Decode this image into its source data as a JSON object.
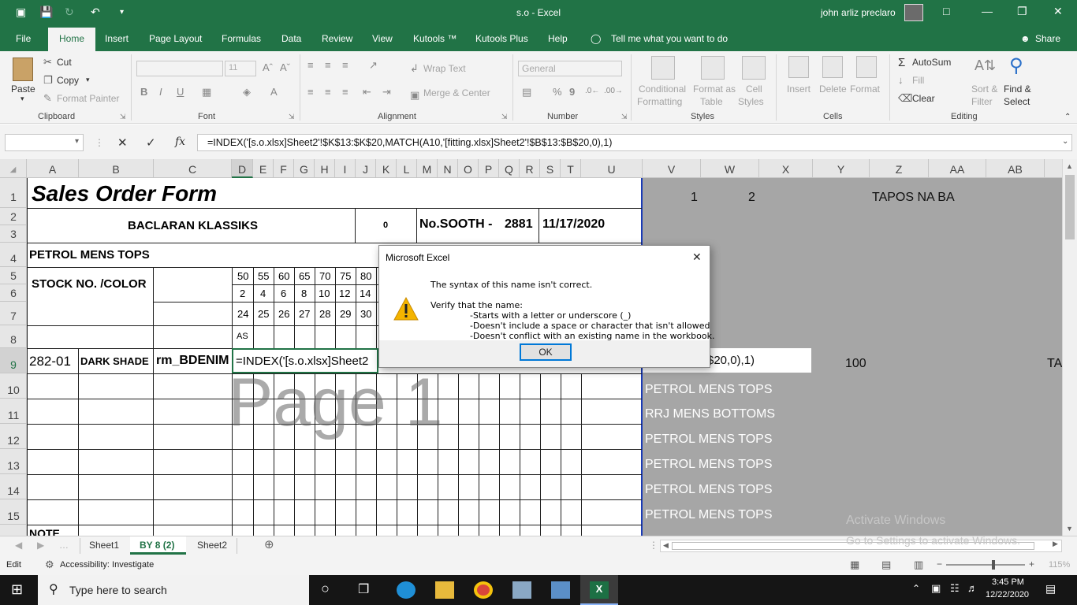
{
  "titlebar": {
    "title": "s.o  -  Excel",
    "user": "john arliz preclaro",
    "minimize": "—",
    "restore": "❐",
    "close": "✕"
  },
  "tabs": [
    "File",
    "Home",
    "Insert",
    "Page Layout",
    "Formulas",
    "Data",
    "Review",
    "View",
    "Kutools ™",
    "Kutools Plus",
    "Help",
    "Tell me what you want to do",
    "Share"
  ],
  "ribbon": {
    "clipboard": {
      "paste": "Paste",
      "cut": "Cut",
      "copy": "Copy",
      "format_painter": "Format Painter",
      "group": "Clipboard"
    },
    "font": {
      "size": "11",
      "group": "Font",
      "bold": "B",
      "italic": "I",
      "underline": "U"
    },
    "alignment": {
      "wrap": "Wrap Text",
      "merge": "Merge & Center",
      "group": "Alignment"
    },
    "number": {
      "format": "General",
      "currency": "$",
      "percent": "%",
      "comma": "9",
      "group": "Number"
    },
    "styles": {
      "conditional": "Conditional",
      "formatting": "Formatting",
      "format_as": "Format as",
      "table": "Table",
      "cell": "Cell",
      "styles_lbl": "Styles",
      "group": "Styles"
    },
    "cells": {
      "insert": "Insert",
      "delete": "Delete",
      "format": "Format",
      "group": "Cells"
    },
    "editing": {
      "autosum": "AutoSum",
      "fill": "Fill",
      "clear": "Clear",
      "sort": "Sort &",
      "filter": "Filter",
      "find": "Find &",
      "select": "Select",
      "group": "Editing"
    }
  },
  "formula_bar": {
    "fx": "fx",
    "cancel": "✕",
    "enter": "✓",
    "formula": "=INDEX('[s.o.xlsx]Sheet2'!$K$13:$K$20,MATCH(A10,'[fitting.xlsx]Sheet2'!$B$13:$B$20,0),1)"
  },
  "columns": [
    "A",
    "B",
    "C",
    "D",
    "E",
    "F",
    "G",
    "H",
    "I",
    "J",
    "K",
    "L",
    "M",
    "N",
    "O",
    "P",
    "Q",
    "R",
    "S",
    "T",
    "U",
    "V",
    "W",
    "X",
    "Y",
    "Z",
    "AA",
    "AB"
  ],
  "rows": [
    "1",
    "2",
    "3",
    "4",
    "5",
    "6",
    "7",
    "8",
    "9",
    "10",
    "11",
    "12",
    "13",
    "14",
    "15"
  ],
  "sheet": {
    "title": "Sales Order Form",
    "customer": "BACLARAN KLASSIKS",
    "zero": "0",
    "no_label": "No.SOOTH -",
    "no_value": "2881",
    "date": "11/17/2020",
    "category": "PETROL MENS TOPS",
    "stock_label": "STOCK NO. /COLOR",
    "sizes_row5": [
      "50",
      "55",
      "60",
      "65",
      "70",
      "75",
      "80"
    ],
    "sizes_row6": [
      "2",
      "4",
      "6",
      "8",
      "10",
      "12",
      "14"
    ],
    "sizes_row7": [
      "24",
      "25",
      "26",
      "27",
      "28",
      "29",
      "30"
    ],
    "as_label": "AS",
    "item_code": "282-01",
    "item_color": "DARK SHADE",
    "item_name": "rm_BDENIM",
    "cell_edit": "=INDEX('[s.o.xlsx]Sheet2",
    "watermark": "Page 1",
    "note": "NOTE"
  },
  "gray_area": {
    "v1": "1",
    "w1": "2",
    "z1": "TAPOS NA BA",
    "formula_tail": "$20,0),1)",
    "y9": "100",
    "ab9": "TA",
    "list": [
      "PETROL MENS TOPS",
      "RRJ MENS BOTTOMS",
      "PETROL MENS TOPS",
      "PETROL MENS TOPS",
      "PETROL MENS TOPS",
      "PETROL MENS TOPS"
    ]
  },
  "sheet_tabs": [
    "Sheet1",
    "BY 8 (2)",
    "Sheet2"
  ],
  "status": {
    "mode": "Edit",
    "accessibility": "Accessibility: Investigate",
    "zoom": "115%",
    "activate1": "Activate Windows",
    "activate2": "Go to Settings to activate Windows."
  },
  "dialog": {
    "title": "Microsoft Excel",
    "line1": "The syntax of this name isn't correct.",
    "line2": "Verify that the name:",
    "bullet1": "-Starts with a letter or underscore (_)",
    "bullet2": "-Doesn't include a space or character that isn't allowed",
    "bullet3": "-Doesn't conflict with an existing name in the workbook.",
    "ok": "OK"
  },
  "taskbar": {
    "search": "Type here to search",
    "time": "3:45 PM",
    "date": "12/22/2020"
  }
}
